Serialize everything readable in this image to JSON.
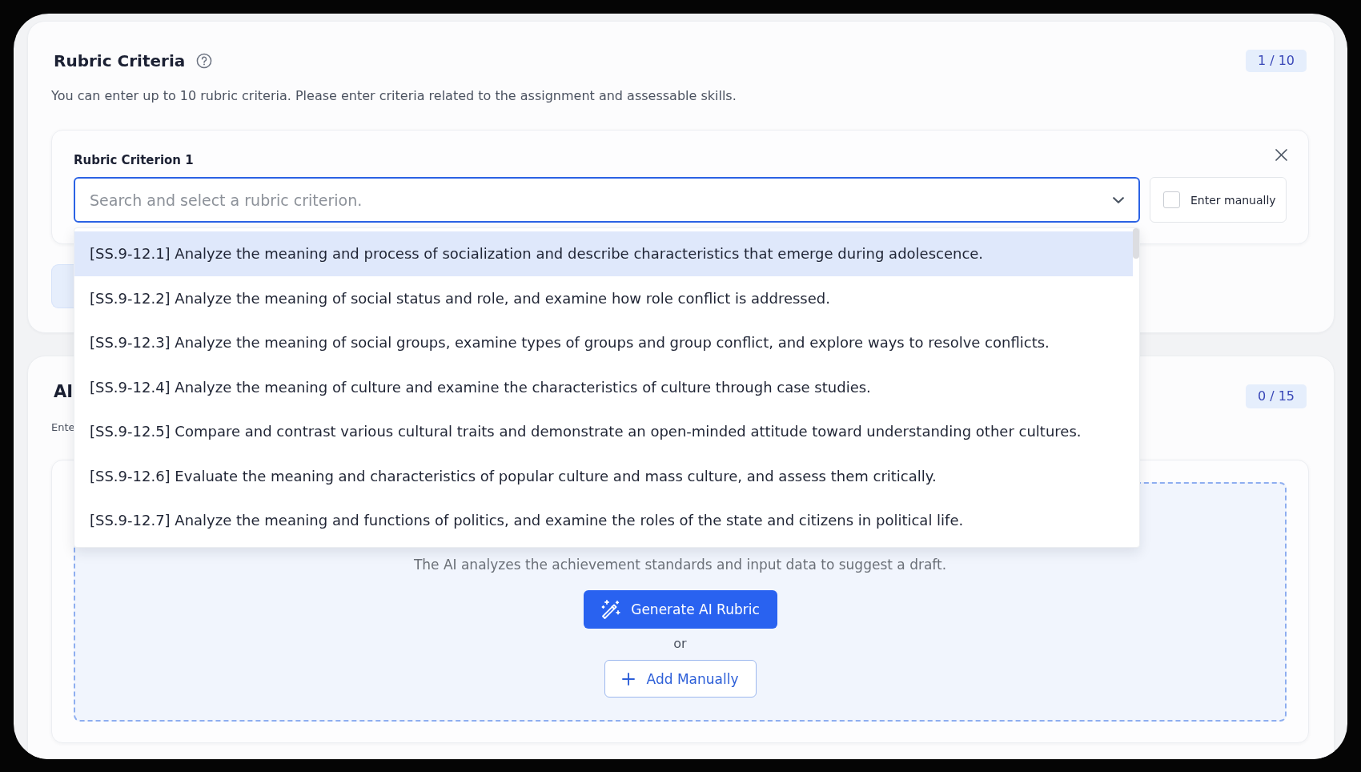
{
  "rubric_section": {
    "title": "Rubric Criteria",
    "counter": "1 / 10",
    "description": "You can enter up to 10 rubric criteria. Please enter criteria related to the assignment and assessable skills.",
    "criteria": [
      {
        "label": "Rubric Criterion 1",
        "select": {
          "placeholder": "Search and select a rubric criterion.",
          "expanded": true,
          "options": [
            {
              "text": "[SS.9-12.1] Analyze the meaning and process of socialization and describe characteristics that emerge during adolescence.",
              "selected": true
            },
            {
              "text": "[SS.9-12.2] Analyze the meaning of social status and role, and examine how role conflict is addressed.",
              "selected": false
            },
            {
              "text": "[SS.9-12.3] Analyze the meaning of social groups, examine types of groups and group conflict, and explore ways to resolve conflicts.",
              "selected": false
            },
            {
              "text": "[SS.9-12.4] Analyze the meaning of culture and examine the characteristics of culture through case studies.",
              "selected": false
            },
            {
              "text": "[SS.9-12.5] Compare and contrast various cultural traits and demonstrate an open-minded attitude toward understanding other cultures.",
              "selected": false
            },
            {
              "text": "[SS.9-12.6] Evaluate the meaning and characteristics of popular culture and mass culture, and assess them critically.",
              "selected": false
            },
            {
              "text": "[SS.9-12.7] Analyze the meaning and functions of politics, and examine the roles of the state and citizens in political life.",
              "selected": false
            }
          ]
        },
        "manual_entry": {
          "label": "Enter manually",
          "checked": false
        }
      }
    ]
  },
  "ai_section": {
    "title": "AI",
    "counter": "0 / 15",
    "description": "Ente",
    "hint": "The AI analyzes the achievement standards and input data to suggest a draft.",
    "buttons": [
      {
        "kind": "primary",
        "label": "Generate AI Rubric"
      },
      {
        "kind": "secondary",
        "label": "Add Manually"
      }
    ],
    "separator": "or"
  }
}
